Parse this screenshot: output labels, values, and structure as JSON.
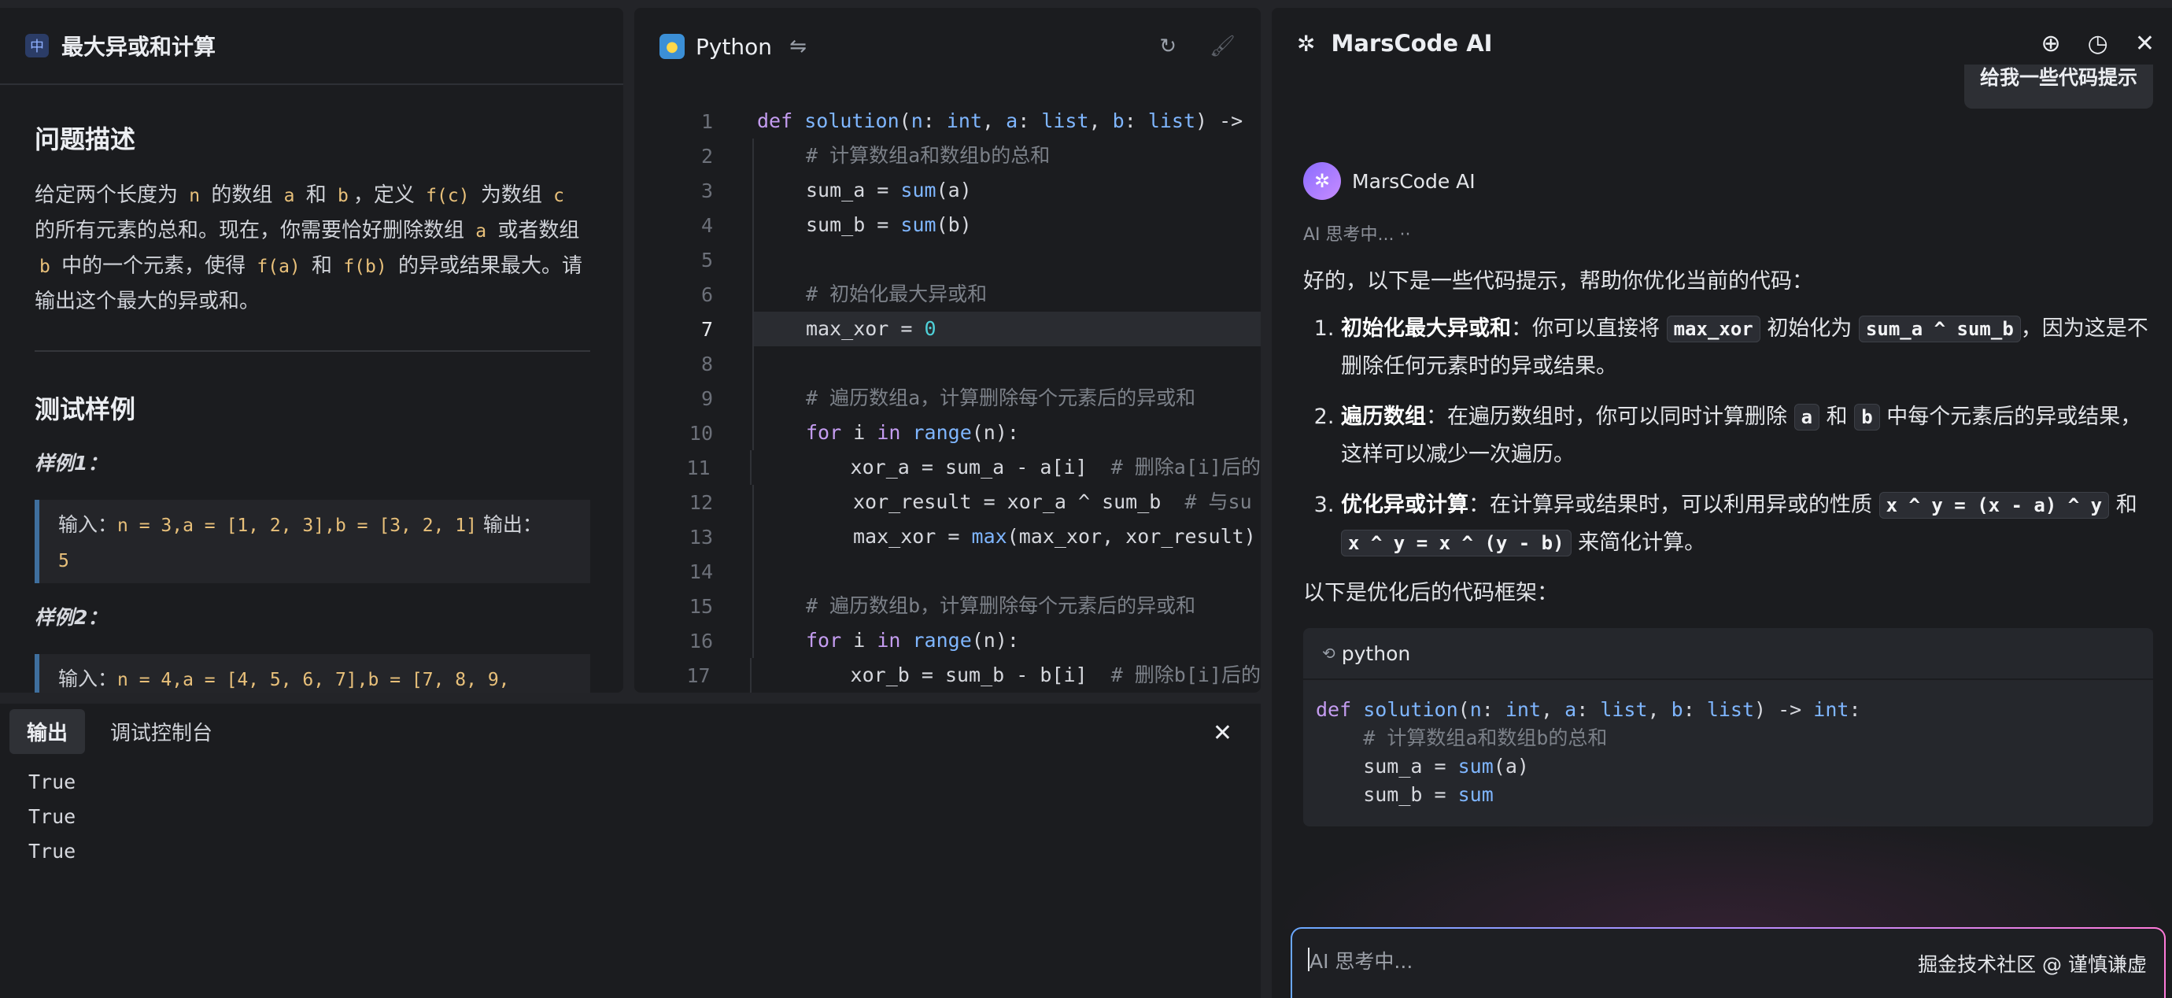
{
  "problem": {
    "badge": "中",
    "title": "最大异或和计算",
    "desc_heading": "问题描述",
    "desc": [
      {
        "t": "给定两个长度为 "
      },
      {
        "c": "n"
      },
      {
        "t": " 的数组 "
      },
      {
        "c": "a"
      },
      {
        "t": " 和 "
      },
      {
        "c": "b"
      },
      {
        "t": "，定义 "
      },
      {
        "c": "f(c)"
      },
      {
        "t": " 为数组 "
      },
      {
        "c": "c"
      },
      {
        "t": " 的所有元素的总和。现在，你需要恰好删除数组 "
      },
      {
        "c": "a"
      },
      {
        "t": " 或者数组 "
      },
      {
        "c": "b"
      },
      {
        "t": " 中的一个元素，使得 "
      },
      {
        "c": "f(a)"
      },
      {
        "t": " 和 "
      },
      {
        "c": "f(b)"
      },
      {
        "t": " 的异或结果最大。请输出这个最大的异或和。"
      }
    ],
    "tests_heading": "测试样例",
    "samples": [
      {
        "label": "样例1：",
        "input_label": "输入：",
        "input": "n = 3,a = [1, 2, 3],b = [3, 2, 1]",
        "output_label": "输出：",
        "output": "5"
      },
      {
        "label": "样例2：",
        "input_label": "输入：",
        "input": "n = 4,a = [4, 5, 6, 7],b = [7, 8, 9,",
        "output_label": "",
        "output": ""
      }
    ]
  },
  "editor": {
    "language": "Python",
    "swap_icon": "swap-icon",
    "reset_icon": "refresh-icon",
    "format_icon": "paint-roller-icon",
    "active_line": 7,
    "lines": [
      {
        "n": "1",
        "indent": 0,
        "parts": [
          [
            "kw",
            "def "
          ],
          [
            "bi",
            "solution"
          ],
          [
            "p",
            "("
          ],
          [
            "ty",
            "n"
          ],
          [
            "p",
            ": "
          ],
          [
            "ty",
            "int"
          ],
          [
            "p",
            ", "
          ],
          [
            "ty",
            "a"
          ],
          [
            "p",
            ": "
          ],
          [
            "ty",
            "list"
          ],
          [
            "p",
            ", "
          ],
          [
            "ty",
            "b"
          ],
          [
            "p",
            ": "
          ],
          [
            "ty",
            "list"
          ],
          [
            "p",
            ") ->"
          ]
        ]
      },
      {
        "n": "2",
        "indent": 1,
        "parts": [
          [
            "cm",
            "# 计算数组a和数组b的总和"
          ]
        ]
      },
      {
        "n": "3",
        "indent": 1,
        "parts": [
          [
            "p",
            "sum_a = "
          ],
          [
            "bi",
            "sum"
          ],
          [
            "p",
            "(a)"
          ]
        ]
      },
      {
        "n": "4",
        "indent": 1,
        "parts": [
          [
            "p",
            "sum_b = "
          ],
          [
            "bi",
            "sum"
          ],
          [
            "p",
            "(b)"
          ]
        ]
      },
      {
        "n": "5",
        "indent": 1,
        "parts": []
      },
      {
        "n": "6",
        "indent": 1,
        "parts": [
          [
            "cm",
            "# 初始化最大异或和"
          ]
        ]
      },
      {
        "n": "7",
        "indent": 1,
        "parts": [
          [
            "p",
            "max_xor = "
          ],
          [
            "num",
            "0"
          ]
        ]
      },
      {
        "n": "8",
        "indent": 1,
        "parts": []
      },
      {
        "n": "9",
        "indent": 1,
        "parts": [
          [
            "cm",
            "# 遍历数组a，计算删除每个元素后的异或和"
          ]
        ]
      },
      {
        "n": "10",
        "indent": 1,
        "parts": [
          [
            "kw",
            "for "
          ],
          [
            "p",
            "i "
          ],
          [
            "kw",
            "in "
          ],
          [
            "bi",
            "range"
          ],
          [
            "p",
            "(n):"
          ]
        ]
      },
      {
        "n": "11",
        "indent": 2,
        "parts": [
          [
            "p",
            "xor_a = sum_a - a[i]  "
          ],
          [
            "cm",
            "# 删除a[i]后的"
          ]
        ]
      },
      {
        "n": "12",
        "indent": 2,
        "parts": [
          [
            "p",
            "xor_result = xor_a ^ sum_b  "
          ],
          [
            "cm",
            "# 与su"
          ]
        ]
      },
      {
        "n": "13",
        "indent": 2,
        "parts": [
          [
            "p",
            "max_xor = "
          ],
          [
            "bi",
            "max"
          ],
          [
            "p",
            "(max_xor, xor_result)"
          ]
        ]
      },
      {
        "n": "14",
        "indent": 1,
        "parts": []
      },
      {
        "n": "15",
        "indent": 1,
        "parts": [
          [
            "cm",
            "# 遍历数组b，计算删除每个元素后的异或和"
          ]
        ]
      },
      {
        "n": "16",
        "indent": 1,
        "parts": [
          [
            "kw",
            "for "
          ],
          [
            "p",
            "i "
          ],
          [
            "kw",
            "in "
          ],
          [
            "bi",
            "range"
          ],
          [
            "p",
            "(n):"
          ]
        ]
      },
      {
        "n": "17",
        "indent": 2,
        "parts": [
          [
            "p",
            "xor_b = sum_b - b[i]  "
          ],
          [
            "cm",
            "# 删除b[i]后的"
          ]
        ]
      }
    ]
  },
  "output": {
    "tabs": [
      "输出",
      "调试控制台"
    ],
    "active_tab": 0,
    "lines": [
      "True",
      "True",
      "True"
    ]
  },
  "ai": {
    "title": "MarsCode AI",
    "header_icons": [
      "new-chat-icon",
      "history-icon",
      "close-icon"
    ],
    "user_message": "给我一些代码提示",
    "bot_name": "MarsCode AI",
    "thinking": "AI 思考中... ··",
    "intro": "好的，以下是一些代码提示，帮助你优化当前的代码：",
    "tips": [
      {
        "title": "初始化最大异或和",
        "parts": [
          {
            "t": "：你可以直接将 "
          },
          {
            "c": "max_xor"
          },
          {
            "t": " 初始化为 "
          },
          {
            "c": "sum_a ^ sum_b"
          },
          {
            "t": "，因为这是不删除任何元素时的异或结果。"
          }
        ]
      },
      {
        "title": "遍历数组",
        "parts": [
          {
            "t": "：在遍历数组时，你可以同时计算删除 "
          },
          {
            "c": "a"
          },
          {
            "t": " 和 "
          },
          {
            "c": "b"
          },
          {
            "t": " 中每个元素后的异或结果，这样可以减少一次遍历。"
          }
        ]
      },
      {
        "title": "优化异或计算",
        "parts": [
          {
            "t": "：在计算异或结果时，可以利用异或的性质 "
          },
          {
            "c": "x ^ y = (x - a) ^ y"
          },
          {
            "t": " 和 "
          },
          {
            "c": "x ^ y = x ^ (y - b)"
          },
          {
            "t": " 来简化计算。"
          }
        ]
      }
    ],
    "framework_text": "以下是优化后的代码框架：",
    "code_lang": "python",
    "code_lines": [
      [
        [
          "kw",
          "def "
        ],
        [
          "bi",
          "solution"
        ],
        [
          "p",
          "("
        ],
        [
          "ty",
          "n"
        ],
        [
          "p",
          ": "
        ],
        [
          "ty",
          "int"
        ],
        [
          "p",
          ", "
        ],
        [
          "ty",
          "a"
        ],
        [
          "p",
          ": "
        ],
        [
          "ty",
          "list"
        ],
        [
          "p",
          ", "
        ],
        [
          "ty",
          "b"
        ],
        [
          "p",
          ": "
        ],
        [
          "ty",
          "list"
        ],
        [
          "p",
          ") -> "
        ],
        [
          "ty",
          "int"
        ],
        [
          "p",
          ":"
        ]
      ],
      [
        [
          "p",
          "    "
        ],
        [
          "cm",
          "# 计算数组a和数组b的总和"
        ]
      ],
      [
        [
          "p",
          "    sum_a = "
        ],
        [
          "bi",
          "sum"
        ],
        [
          "p",
          "(a)"
        ]
      ],
      [
        [
          "p",
          "    sum_b = "
        ],
        [
          "bi",
          "sum"
        ]
      ]
    ],
    "input_placeholder": "AI 思考中...",
    "watermark": "掘金技术社区 @ 谨慎谦虚"
  }
}
